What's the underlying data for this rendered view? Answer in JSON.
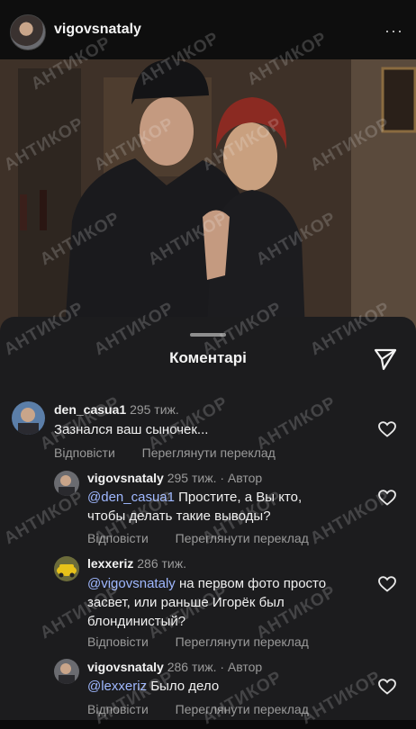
{
  "header": {
    "username": "vigovsnataly",
    "more_icon": "···"
  },
  "sheet": {
    "title": "Коментарі"
  },
  "comments": [
    {
      "user": "den_casua1",
      "time": "295 тиж.",
      "author": "",
      "text": "Зазнался ваш сыночек...",
      "mention": "",
      "reply": "Відповісти",
      "translate": "Переглянути переклад"
    },
    {
      "user": "vigovsnataly",
      "time": "295 тиж.",
      "author": "· Автор",
      "mention": "@den_casua1",
      "text_line1": " Простите, а Вы  кто,",
      "text_line2": "чтобы делать такие выводы?",
      "reply": "Відповісти",
      "translate": "Переглянути переклад"
    },
    {
      "user": "lexxeriz",
      "time": "286 тиж.",
      "author": "",
      "mention": "@vigovsnataly",
      "text_line1": " на первом фото просто",
      "text_line2": "засвет, или раньше Игорёк был",
      "text_line3": "блондинистый?",
      "reply": "Відповісти",
      "translate": "Переглянути переклад"
    },
    {
      "user": "vigovsnataly",
      "time": "286 тиж.",
      "author": "· Автор",
      "mention": "@lexxeriz",
      "text": " Было дело",
      "reply": "Відповісти",
      "translate": "Переглянути переклад"
    }
  ],
  "watermark": "АНТИКОР"
}
